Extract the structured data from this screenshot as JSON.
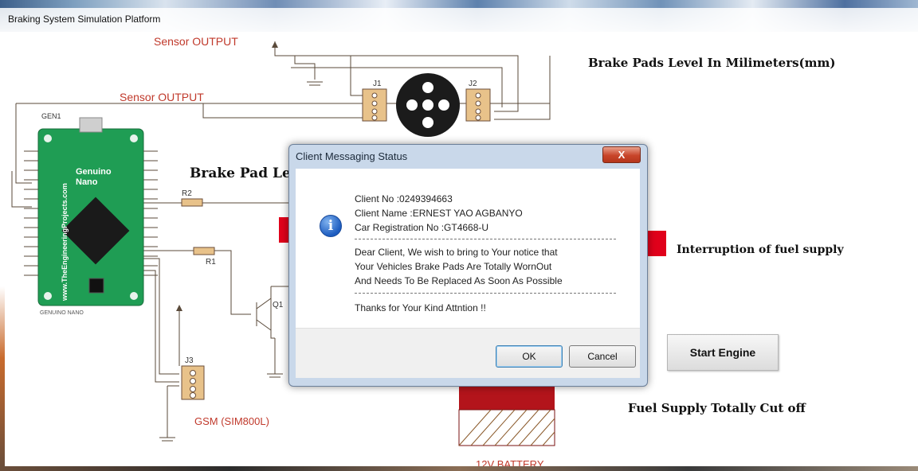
{
  "window": {
    "title": "Braking System Simulation Platform"
  },
  "schematic": {
    "sensor_output_top": "Sensor OUTPUT",
    "sensor_output_mid": "Sensor OUTPUT",
    "gen1": "GEN1",
    "board_name": "Genuino Nano",
    "board_site": "www.TheEngineeringProjects.com",
    "board_caption": "GENUINO NANO",
    "r1": "R1",
    "r2": "R2",
    "q1": "Q1",
    "j1": "J1",
    "j2": "J2",
    "j3": "J3",
    "gsm": "GSM (SIM800L)",
    "battery": "12V BATTERY",
    "gnd": "GND"
  },
  "panel": {
    "brake_pads_level": "Brake Pads Level  In Milimeters(mm)",
    "brake_pad_level_partial": "Brake Pad Le",
    "interruption": "Interruption of fuel supply",
    "fuel_cut": "Fuel Supply Totally Cut off",
    "start_engine": "Start Engine",
    "accent_red": "#e0001b"
  },
  "dialog": {
    "title": "Client Messaging Status",
    "close": "X",
    "client_no": "Client No :0249394663",
    "client_name": "Client Name :ERNEST YAO AGBANYO",
    "car_reg": "Car Registration No :GT4668-U",
    "line1": "Dear Client, We wish to bring to Your notice that",
    "line2": "Your Vehicles Brake Pads Are Totally WornOut",
    "line3": "And Needs To Be Replaced As Soon As Possible",
    "thanks": "Thanks for Your Kind Attntion !!",
    "ok": "OK",
    "cancel": "Cancel",
    "icon": "info-icon"
  }
}
